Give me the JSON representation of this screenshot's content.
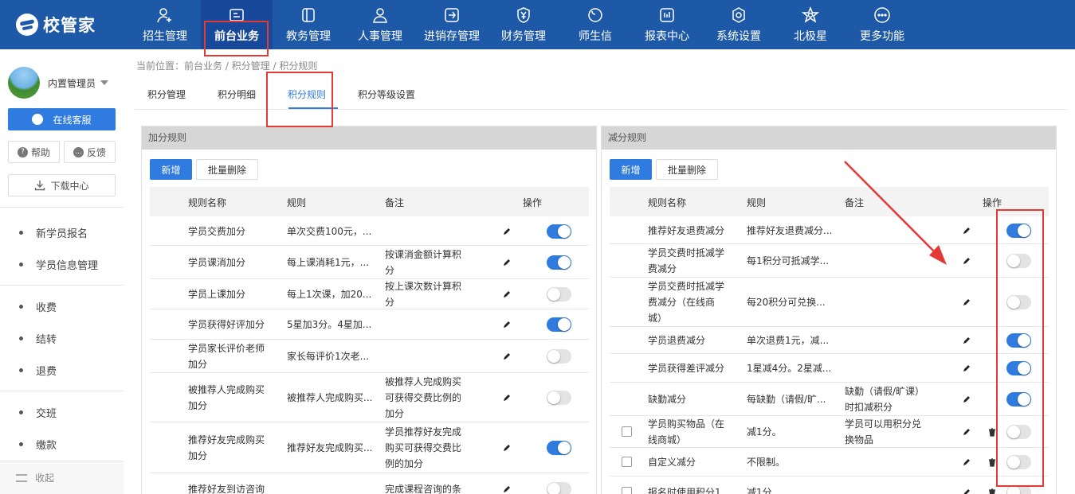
{
  "brand": {
    "name": "校管家"
  },
  "nav": [
    {
      "label": "招生管理",
      "icon": "add-user-icon"
    },
    {
      "label": "前台业务",
      "icon": "desk-icon"
    },
    {
      "label": "教务管理",
      "icon": "book-icon"
    },
    {
      "label": "人事管理",
      "icon": "person-icon"
    },
    {
      "label": "进销存管理",
      "icon": "inventory-icon"
    },
    {
      "label": "财务管理",
      "icon": "yen-shield-icon"
    },
    {
      "label": "师生信",
      "icon": "chat-icon"
    },
    {
      "label": "报表中心",
      "icon": "report-icon"
    },
    {
      "label": "系统设置",
      "icon": "gear-icon"
    },
    {
      "label": "北极星",
      "icon": "star-icon"
    },
    {
      "label": "更多功能",
      "icon": "more-icon"
    }
  ],
  "sidebar": {
    "user": "内置管理员",
    "service": "在线客服",
    "help": "帮助",
    "feedback": "反馈",
    "download": "下载中心",
    "items": [
      "新学员报名",
      "学员信息管理",
      "收费",
      "结转",
      "退费",
      "交班",
      "缴款"
    ],
    "collapse": "收起"
  },
  "breadcrumb": "当前位置：前台业务 / 积分管理 / 积分规则",
  "tabs": [
    "积分管理",
    "积分明细",
    "积分规则",
    "积分等级设置"
  ],
  "add_panel": {
    "title": "加分规则",
    "new_btn": "新增",
    "bulk_delete_btn": "批量删除",
    "columns": {
      "name": "规则名称",
      "rule": "规则",
      "remark": "备注",
      "ops": "操作"
    },
    "rows": [
      {
        "name": [
          "学员交费加分"
        ],
        "rule": "单次交费100元，...",
        "remark": [],
        "enabled": true
      },
      {
        "name": [
          "学员课消加分"
        ],
        "rule": "每上课消耗1元，...",
        "remark": [
          "按课消金额计算积",
          "分"
        ],
        "enabled": true
      },
      {
        "name": [
          "学员上课加分"
        ],
        "rule": "每上1次课，加20...",
        "remark": [
          "按上课次数计算积",
          "分"
        ],
        "enabled": false
      },
      {
        "name": [
          "学员获得好评加分"
        ],
        "rule": "5星加3分。4星加...",
        "remark": [],
        "enabled": true
      },
      {
        "name": [
          "学员家长评价老师",
          "加分"
        ],
        "rule": "家长每评价1次老...",
        "remark": [],
        "enabled": false
      },
      {
        "name": [
          "被推荐人完成购买",
          "加分"
        ],
        "rule": "被推荐人完成购买...",
        "remark": [
          "被推荐人完成购买",
          "可获得交费比例的",
          "加分"
        ],
        "enabled": false
      },
      {
        "name": [
          "推荐好友完成购买",
          "加分"
        ],
        "rule": "推荐好友完成购买...",
        "remark": [
          "学员推荐好友完成",
          "购买可获得交费比",
          "例的加分"
        ],
        "enabled": true
      },
      {
        "name": [
          "推荐好友到访咨询"
        ],
        "rule": "",
        "remark": [
          "完成课程咨询的条"
        ],
        "enabled": false
      }
    ]
  },
  "sub_panel": {
    "title": "减分规则",
    "new_btn": "新增",
    "bulk_delete_btn": "批量删除",
    "columns": {
      "name": "规则名称",
      "rule": "规则",
      "remark": "备注",
      "ops": "操作"
    },
    "rows": [
      {
        "name": [
          "推荐好友退费减分"
        ],
        "rule": "推荐好友退费减分...",
        "remark": [],
        "enabled": true
      },
      {
        "name": [
          "学员交费时抵减学",
          "费减分"
        ],
        "rule": "每1积分可抵减学...",
        "remark": [],
        "enabled": false
      },
      {
        "name": [
          "学员交费时抵减学",
          "费减分（在线商",
          "城）"
        ],
        "rule": "每20积分可兑换...",
        "remark": [],
        "enabled": false
      },
      {
        "name": [
          "学员退费减分"
        ],
        "rule": "单次退费1元，减...",
        "remark": [],
        "enabled": true
      },
      {
        "name": [
          "学员获得差评减分"
        ],
        "rule": "1星减4分。2星减...",
        "remark": [],
        "enabled": true
      },
      {
        "name": [
          "缺勤减分"
        ],
        "rule": "每缺勤（请假/旷...",
        "remark": [
          "缺勤（请假/旷课）",
          "时扣减积分"
        ],
        "enabled": true
      },
      {
        "name": [
          "学员购买物品（在",
          "线商城）"
        ],
        "rule": "减1分。",
        "remark": [
          "学员可以用积分兑",
          "换物品"
        ],
        "enabled": false
      },
      {
        "name": [
          "自定义减分"
        ],
        "rule": "不限制。",
        "remark": [],
        "enabled": false
      },
      {
        "name": [
          "报名时使用积分1"
        ],
        "rule": "减1分",
        "remark": [],
        "enabled": false
      }
    ]
  },
  "colors": {
    "topbar": "#1e59a8",
    "accent": "#2f7be0",
    "highlight": "#e33a35"
  }
}
